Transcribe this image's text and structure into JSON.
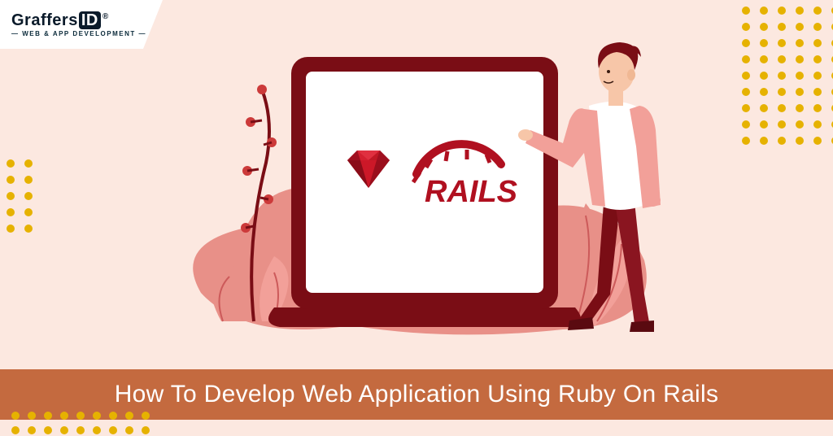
{
  "logo": {
    "name_part1": "Graffers",
    "name_part2": "ID",
    "registered": "®",
    "tagline": "— WEB & APP DEVELOPMENT —"
  },
  "illustration": {
    "rails_label": "RAILS",
    "ruby_icon": "ruby-gem-icon",
    "rails_icon": "rails-arc-icon"
  },
  "banner": {
    "title": "How To Develop Web Application Using Ruby On Rails"
  },
  "colors": {
    "background": "#fce8e0",
    "banner": "#c46a3f",
    "accent_dark": "#7a0d15",
    "accent_mid": "#cc3a3a",
    "accent_light": "#f2a099",
    "dot": "#e6b200"
  }
}
